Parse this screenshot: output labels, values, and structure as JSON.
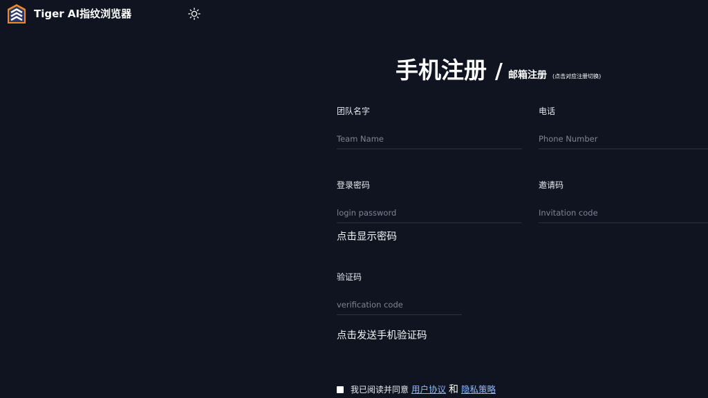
{
  "app": {
    "title": "Tiger AI指纹浏览器",
    "logo_icon": "tiger-logo-icon",
    "theme_icon": "sun-icon"
  },
  "register": {
    "phone_tab": "手机注册",
    "separator": "/",
    "email_tab": "邮箱注册",
    "hint": "(点击对应注册切换)"
  },
  "form": {
    "team_name": {
      "label": "团队名字",
      "placeholder": "Team Name"
    },
    "phone": {
      "label": "电话",
      "placeholder": "Phone Number"
    },
    "password": {
      "label": "登录密码",
      "placeholder": "login password"
    },
    "invitation": {
      "label": "邀请码",
      "placeholder": "Invitation code"
    },
    "show_password": "点击显示密码",
    "verification": {
      "label": "验证码",
      "placeholder": "verification code"
    },
    "send_code": "点击发送手机验证码"
  },
  "agreement": {
    "prefix": "我已阅读并同意",
    "user_agreement": "用户协议",
    "and": "和",
    "privacy_policy": "隐私策略"
  },
  "colors": {
    "background": "#0f1420",
    "link": "#8fb8ff",
    "logo_orange": "#f08a24",
    "logo_navy": "#2b3a67"
  }
}
